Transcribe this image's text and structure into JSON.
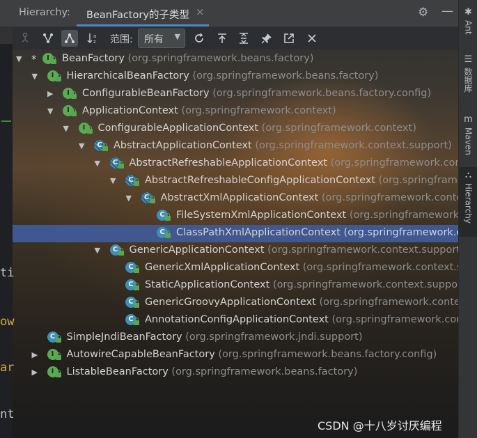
{
  "panel": {
    "title": "Hierarchy:",
    "tab_label": "BeanFactory的子类型",
    "tab_close": "×"
  },
  "toolbar": {
    "scope_label": "范围:",
    "scope_value": "所有"
  },
  "tree": [
    {
      "indent": 0,
      "arrow": "down",
      "star": "*",
      "kind": "i",
      "name": "BeanFactory",
      "pkg": "(org.springframework.beans.factory)"
    },
    {
      "indent": 1,
      "arrow": "down",
      "kind": "i",
      "name": "HierarchicalBeanFactory",
      "pkg": "(org.springframework.beans.factory)"
    },
    {
      "indent": 2,
      "arrow": "right",
      "kind": "i",
      "name": "ConfigurableBeanFactory",
      "pkg": "(org.springframework.beans.factory.config)"
    },
    {
      "indent": 2,
      "arrow": "down",
      "kind": "i",
      "name": "ApplicationContext",
      "pkg": "(org.springframework.context)"
    },
    {
      "indent": 3,
      "arrow": "down",
      "kind": "i",
      "name": "ConfigurableApplicationContext",
      "pkg": "(org.springframework.context)"
    },
    {
      "indent": 4,
      "arrow": "down",
      "kind": "a",
      "name": "AbstractApplicationContext",
      "pkg": "(org.springframework.context.support)"
    },
    {
      "indent": 5,
      "arrow": "down",
      "kind": "a",
      "name": "AbstractRefreshableApplicationContext",
      "pkg": "(org.springframework.context.support)"
    },
    {
      "indent": 6,
      "arrow": "down",
      "kind": "a",
      "name": "AbstractRefreshableConfigApplicationContext",
      "pkg": "(org.springframework.context.support)"
    },
    {
      "indent": 7,
      "arrow": "down",
      "kind": "a",
      "name": "AbstractXmlApplicationContext",
      "pkg": "(org.springframework.context.support)"
    },
    {
      "indent": 8,
      "arrow": "none",
      "kind": "c",
      "name": "FileSystemXmlApplicationContext",
      "pkg": "(org.springframework.context.support)"
    },
    {
      "indent": 8,
      "arrow": "none",
      "kind": "c",
      "name": "ClassPathXmlApplicationContext",
      "pkg": "(org.springframework.context.support)",
      "selected": true
    },
    {
      "indent": 5,
      "arrow": "down",
      "kind": "c",
      "name": "GenericApplicationContext",
      "pkg": "(org.springframework.context.support)"
    },
    {
      "indent": 6,
      "arrow": "none",
      "kind": "c",
      "name": "GenericXmlApplicationContext",
      "pkg": "(org.springframework.context.support)"
    },
    {
      "indent": 6,
      "arrow": "none",
      "kind": "c",
      "name": "StaticApplicationContext",
      "pkg": "(org.springframework.context.support)"
    },
    {
      "indent": 6,
      "arrow": "none",
      "kind": "c",
      "name": "GenericGroovyApplicationContext",
      "pkg": "(org.springframework.context.support)"
    },
    {
      "indent": 6,
      "arrow": "none",
      "kind": "c",
      "name": "AnnotationConfigApplicationContext",
      "pkg": "(org.springframework.context.annotation)"
    },
    {
      "indent": 1,
      "arrow": "none",
      "kind": "c",
      "name": "SimpleJndiBeanFactory",
      "pkg": "(org.springframework.jndi.support)"
    },
    {
      "indent": 1,
      "arrow": "right",
      "kind": "i",
      "name": "AutowireCapableBeanFactory",
      "pkg": "(org.springframework.beans.factory.config)"
    },
    {
      "indent": 1,
      "arrow": "right",
      "kind": "i",
      "name": "ListableBeanFactory",
      "pkg": "(org.springframework.beans.factory)"
    }
  ],
  "side_tools": [
    {
      "icon": "ant-icon",
      "glyph": "✱",
      "label": "Ant"
    },
    {
      "icon": "database-icon",
      "glyph": "☰",
      "label": "数据库"
    },
    {
      "icon": "maven-icon",
      "glyph": "m",
      "label": "Maven"
    },
    {
      "icon": "hierarchy-icon",
      "glyph": "⛬",
      "label": "Hierarchy"
    }
  ],
  "editor_edge": [
    "ti",
    "ow",
    "ar",
    "nt"
  ],
  "watermark": "CSDN @十八岁讨厌编程",
  "colors": {
    "selection": "#40588f",
    "tab_underline": "#4a88c7",
    "interface_icon": "#5bab51",
    "class_icon": "#3f8fb5",
    "package_text": "#8d8d8d"
  }
}
